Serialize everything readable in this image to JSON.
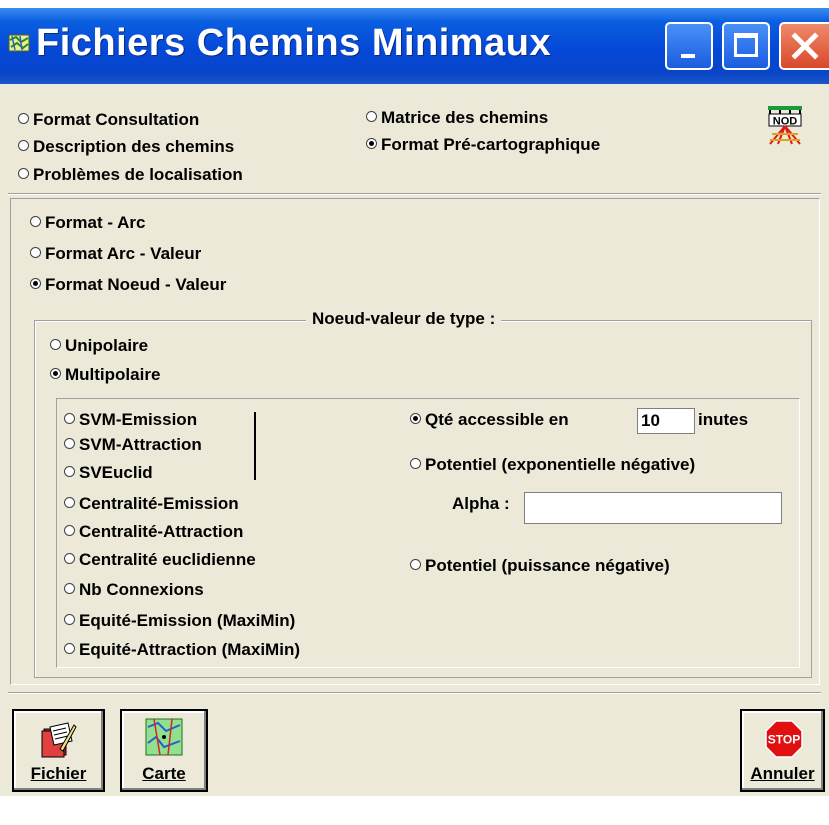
{
  "window": {
    "title": "Fichiers Chemins Minimaux",
    "controls": {
      "minimize": "_",
      "maximize": "□",
      "close": "✕"
    }
  },
  "top_options": {
    "left": [
      {
        "label": "Format Consultation",
        "checked": false
      },
      {
        "label": "Description des chemins",
        "checked": false
      },
      {
        "label": "Problèmes de localisation",
        "checked": false
      }
    ],
    "right": [
      {
        "label": "Matrice des chemins",
        "checked": false
      },
      {
        "label": "Format Pré-cartographique",
        "checked": true
      }
    ],
    "logo_text": "NOD"
  },
  "format_options": [
    {
      "label": "Format - Arc",
      "checked": false
    },
    {
      "label": "Format Arc - Valeur",
      "checked": false
    },
    {
      "label": "Format Noeud - Valeur",
      "checked": true
    }
  ],
  "noeud_group": {
    "title": "Noeud-valeur de type :",
    "types": [
      {
        "label": "Unipolaire",
        "checked": false
      },
      {
        "label": "Multipolaire",
        "checked": true
      }
    ]
  },
  "indicators": [
    {
      "label": "SVM-Emission",
      "checked": false
    },
    {
      "label": "SVM-Attraction",
      "checked": false
    },
    {
      "label": "SVEuclid",
      "checked": false
    },
    {
      "label": "Centralité-Emission",
      "checked": false
    },
    {
      "label": "Centralité-Attraction",
      "checked": false
    },
    {
      "label": "Centralité euclidienne",
      "checked": false
    },
    {
      "label": "Nb Connexions",
      "checked": false
    },
    {
      "label": "Equité-Emission (MaxiMin)",
      "checked": false
    },
    {
      "label": "Equité-Attraction (MaxiMin)",
      "checked": false
    }
  ],
  "measures": {
    "qte": {
      "label": "Qté accessible en",
      "value": "10",
      "suffix": "inutes",
      "checked": true
    },
    "potentiel_exp": {
      "label": "Potentiel (exponentielle négative)",
      "checked": false
    },
    "alpha": {
      "label": "Alpha :",
      "value": ""
    },
    "potentiel_puis": {
      "label": "Potentiel (puissance négative)",
      "checked": false
    }
  },
  "buttons": {
    "fichier": "Fichier",
    "carte": "Carte",
    "stop": "STOP",
    "annuler": "Annuler"
  },
  "colors": {
    "titlebar": "#0548d8",
    "face": "#ece9d8",
    "close": "#d8482a"
  }
}
